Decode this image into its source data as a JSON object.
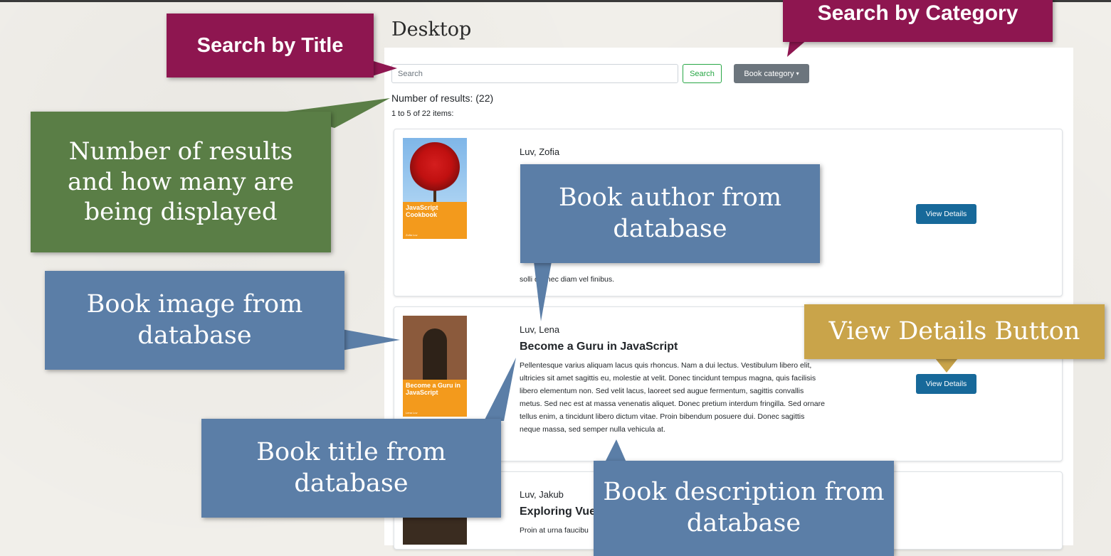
{
  "page": {
    "heading": "Desktop"
  },
  "search": {
    "placeholder": "Search",
    "button_label": "Search",
    "category_label": "Book category",
    "category_caret": "▾"
  },
  "results": {
    "count_text": "Number of results: (22)",
    "range_text": "1 to 5 of 22 items:"
  },
  "books": [
    {
      "author": "Luv, Zofia",
      "title": "",
      "description": "solli  din nec diam vel finibus.",
      "cover_title": "JavaScript Cookbook",
      "cover_author": "Zofia Luv",
      "button_label": "View Details"
    },
    {
      "author": "Luv, Lena",
      "title": "Become a Guru in JavaScript",
      "description": "Pellentesque varius aliquam lacus quis rhoncus. Nam a dui lectus. Vestibulum libero elit, ultricies sit amet sagittis eu, molestie at velit. Donec tincidunt tempus magna, quis facilisis libero elementum non. Sed velit lacus, laoreet sed augue fermentum, sagittis convallis metus. Sed nec est at massa venenatis aliquet. Donec pretium interdum fringilla. Sed ornare tellus enim, a tincidunt libero dictum vitae. Proin bibendum posuere dui. Donec sagittis neque massa, sed semper nulla vehicula at.",
      "cover_title": "Become a Guru in JavaScript",
      "cover_author": "Lena Luv",
      "button_label": "View Details"
    },
    {
      "author": "Luv, Jakub",
      "title": "Exploring Vue",
      "description": "Proin at urna faucibu",
      "cover_title": "",
      "cover_author": "",
      "button_label": ""
    }
  ],
  "annotations": {
    "search_title": "Search by Title",
    "search_category": "Search by Category",
    "results_info": "Number of results and how many are being displayed",
    "book_image": "Book image from database",
    "book_author": "Book author from database",
    "view_details": "View Details Button",
    "book_title": "Book title from database",
    "book_description": "Book description from database"
  },
  "colors": {
    "maroon_callout": "#8e1650",
    "green_callout": "#5a7e46",
    "blue_callout": "#5b7ea7",
    "gold_callout": "#c9a44a",
    "details_button": "#17699a",
    "search_button_outline": "#28a745",
    "category_button": "#6c757d"
  }
}
